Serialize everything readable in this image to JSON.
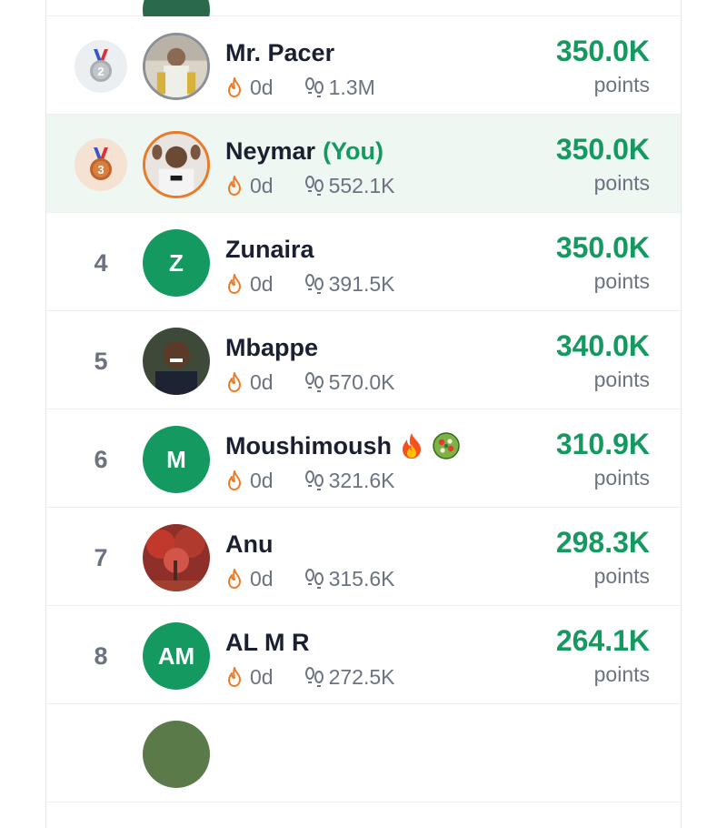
{
  "leaderboard": {
    "colors": {
      "accent": "#149a61",
      "current_row_bg": "#eef7f2",
      "silver": "#8b8f96",
      "bronze": "#ea7a2a"
    },
    "rows": [
      {
        "rank": "",
        "name": "",
        "you_label": "",
        "streak": "",
        "steps": "",
        "points": "",
        "points_label": ""
      },
      {
        "rank": "2",
        "medal": "silver",
        "avatar": "photo",
        "name": "Mr. Pacer",
        "you_label": "",
        "streak": "0d",
        "steps": "1.3M",
        "points": "350.0K",
        "points_label": "points"
      },
      {
        "rank": "3",
        "medal": "bronze",
        "avatar": "photo",
        "name": "Neymar",
        "you_label": "(You)",
        "streak": "0d",
        "steps": "552.1K",
        "points": "350.0K",
        "points_label": "points"
      },
      {
        "rank": "4",
        "avatar_initials": "Z",
        "name": "Zunaira",
        "you_label": "",
        "streak": "0d",
        "steps": "391.5K",
        "points": "350.0K",
        "points_label": "points"
      },
      {
        "rank": "5",
        "avatar": "photo",
        "name": "Mbappe",
        "you_label": "",
        "streak": "0d",
        "steps": "570.0K",
        "points": "340.0K",
        "points_label": "points"
      },
      {
        "rank": "6",
        "avatar_initials": "M",
        "name": "Moushimoush",
        "name_emoji": [
          "fire-emoji",
          "salad-emoji"
        ],
        "you_label": "",
        "streak": "0d",
        "steps": "321.6K",
        "points": "310.9K",
        "points_label": "points"
      },
      {
        "rank": "7",
        "avatar": "photo",
        "name": "Anu",
        "you_label": "",
        "streak": "0d",
        "steps": "315.6K",
        "points": "298.3K",
        "points_label": "points"
      },
      {
        "rank": "8",
        "avatar_initials": "AM",
        "name": "AL M R",
        "you_label": "",
        "streak": "0d",
        "steps": "272.5K",
        "points": "264.1K",
        "points_label": "points"
      }
    ],
    "icons": {
      "streak": "flame-icon",
      "steps": "footprints-icon",
      "medal": "medal-icon"
    }
  }
}
